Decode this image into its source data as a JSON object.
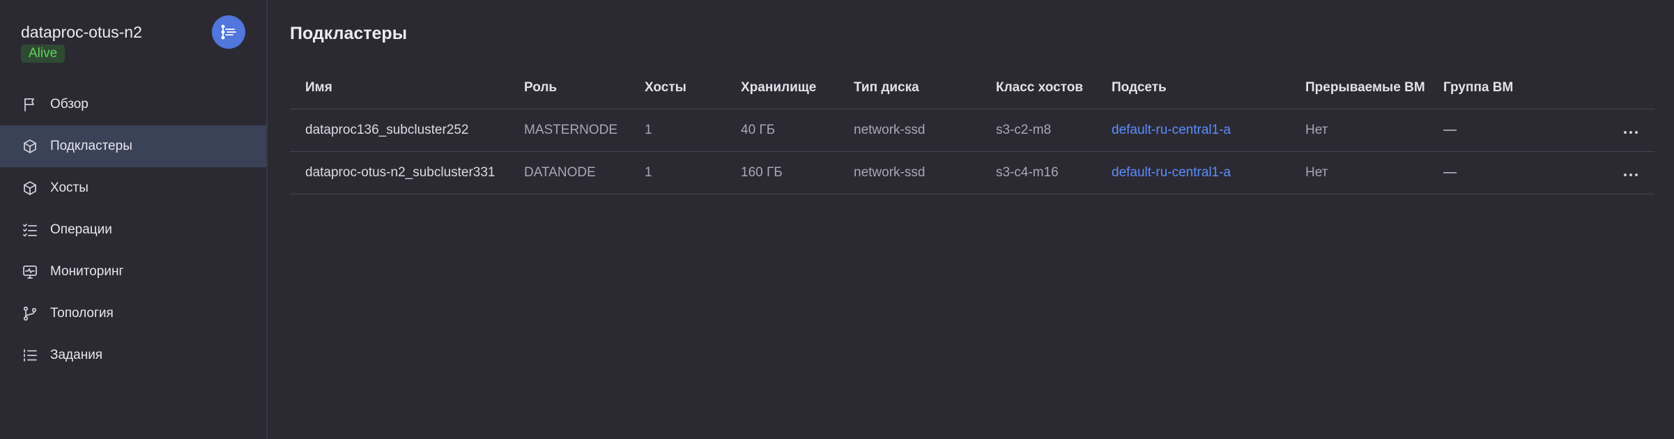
{
  "cluster": {
    "name": "dataproc-otus-n2",
    "status": "Alive",
    "logo_icon": "dataproc-logo-icon",
    "logo_color": "#5176dc",
    "status_color": "#5fd35f"
  },
  "sidebar": {
    "items": [
      {
        "label": "Обзор",
        "icon": "flag-icon",
        "active": false
      },
      {
        "label": "Подкластеры",
        "icon": "cube-icon",
        "active": true
      },
      {
        "label": "Хосты",
        "icon": "cube-icon",
        "active": false
      },
      {
        "label": "Операции",
        "icon": "checklist-icon",
        "active": false
      },
      {
        "label": "Мониторинг",
        "icon": "monitor-icon",
        "active": false
      },
      {
        "label": "Топология",
        "icon": "branch-icon",
        "active": false
      },
      {
        "label": "Задания",
        "icon": "list-icon",
        "active": false
      }
    ]
  },
  "main": {
    "title": "Подкластеры",
    "table": {
      "columns": [
        "Имя",
        "Роль",
        "Хосты",
        "Хранилище",
        "Тип диска",
        "Класс хостов",
        "Подсеть",
        "Прерываемые ВМ",
        "Группа ВМ"
      ],
      "rows": [
        {
          "name": "dataproc136_subcluster252",
          "role": "MASTERNODE",
          "hosts": "1",
          "storage": "40 ГБ",
          "disk_type": "network-ssd",
          "host_class": "s3-c2-m8",
          "subnet": "default-ru-central1-a",
          "preemptible": "Нет",
          "vm_group": "—"
        },
        {
          "name": "dataproc-otus-n2_subcluster331",
          "role": "DATANODE",
          "hosts": "1",
          "storage": "160 ГБ",
          "disk_type": "network-ssd",
          "host_class": "s3-c4-m16",
          "subnet": "default-ru-central1-a",
          "preemptible": "Нет",
          "vm_group": "—"
        }
      ]
    }
  },
  "colors": {
    "background": "#2b2a33",
    "active_item": "#3a4258",
    "link": "#5c8dff"
  }
}
